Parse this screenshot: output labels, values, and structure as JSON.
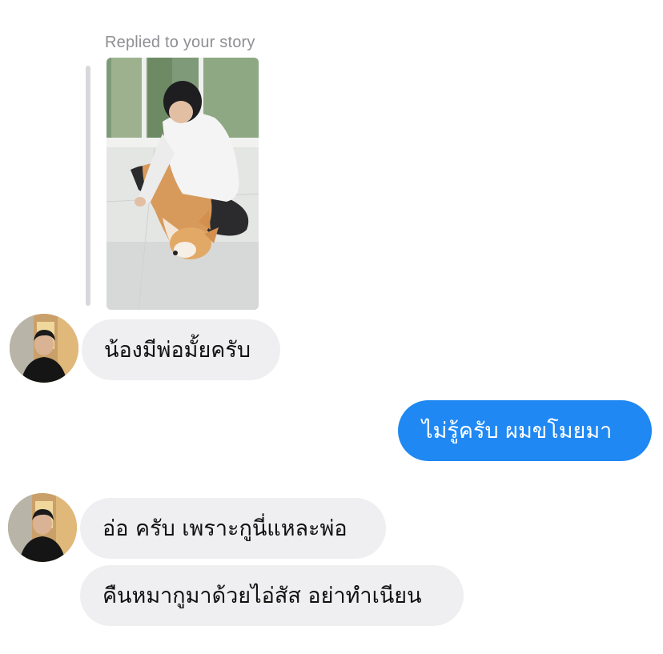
{
  "story_reply": {
    "caption": "Replied to your story",
    "image_alt": "Story photo: man sitting on floor with corgi dog"
  },
  "messages": [
    {
      "sender": "them",
      "text": "น้องมีพ่อมั้ยครับ"
    },
    {
      "sender": "me",
      "text": "ไม่รู้ครับ ผมขโมยมา"
    },
    {
      "sender": "them",
      "text": "อ่อ ครับ เพราะกูนี่แหละพ่อ"
    },
    {
      "sender": "them",
      "text": "คืนหมากูมาด้วยไอ่สัส อย่าทำเนียน"
    }
  ],
  "colors": {
    "incoming_bubble": "#efeff1",
    "outgoing_bubble": "#1f88f2",
    "caption_text": "#8e8e93"
  }
}
